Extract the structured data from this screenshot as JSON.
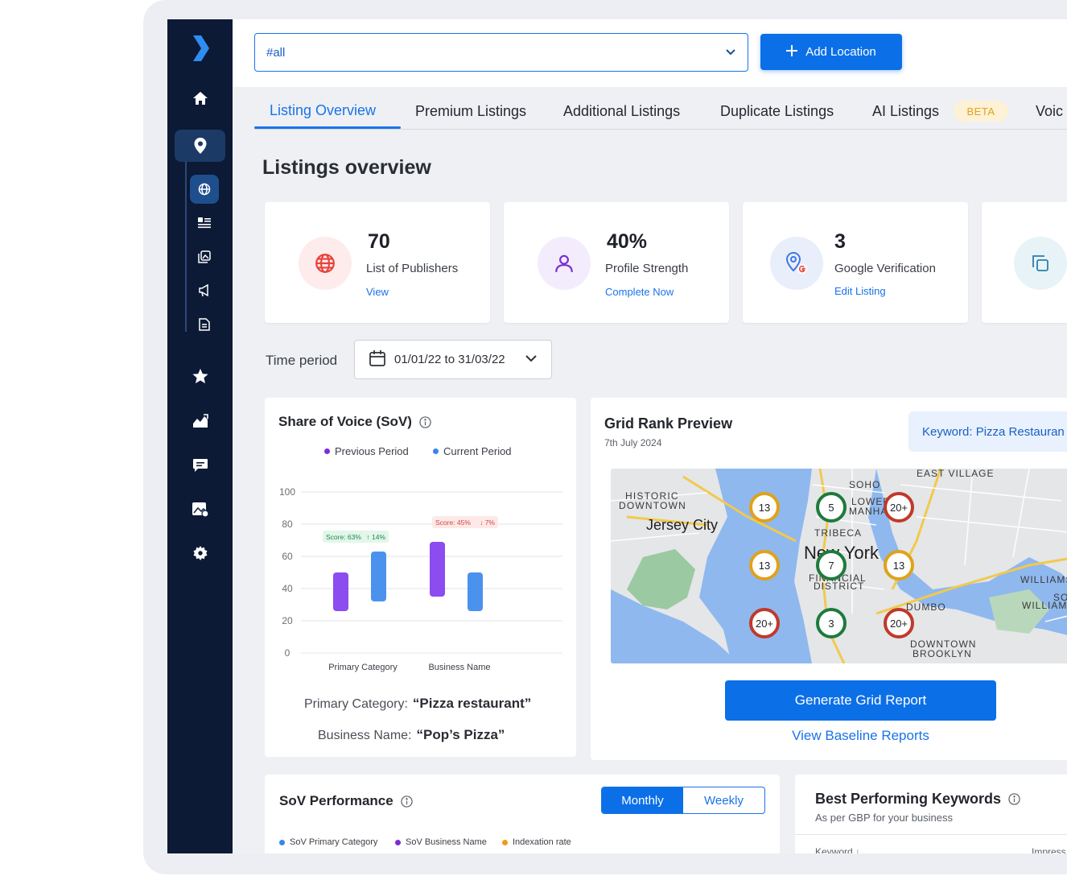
{
  "search": {
    "value": "#all"
  },
  "header": {
    "add_location_label": "Add Location"
  },
  "tabs": [
    {
      "label": "Listing Overview"
    },
    {
      "label": "Premium Listings"
    },
    {
      "label": "Additional Listings"
    },
    {
      "label": "Duplicate Listings"
    },
    {
      "label": "AI Listings"
    },
    {
      "label": "Voic"
    }
  ],
  "beta_label": "BETA",
  "page_title": "Listings overview",
  "stats": [
    {
      "value": "70",
      "label": "List of Publishers",
      "link": "View",
      "icon": "globe-icon",
      "color": "#e9423a"
    },
    {
      "value": "40%",
      "label": "Profile Strength",
      "link": "Complete Now",
      "icon": "user-icon",
      "color": "#7a2ed6"
    },
    {
      "value": "3",
      "label": "Google Verification",
      "link": "Edit Listing",
      "icon": "google-pin-icon",
      "color": "#3f76e8"
    }
  ],
  "time_period": {
    "label": "Time period",
    "value": "01/01/22 to 31/03/22"
  },
  "sov": {
    "title": "Share of Voice (SoV)",
    "primary_category_label": "Primary Category:",
    "primary_category_value": "“Pizza restaurant”",
    "business_name_label": "Business Name:",
    "business_name_value": "“Pop’s Pizza”"
  },
  "chart_data": {
    "type": "bar",
    "categories": [
      "Primary Category",
      "Business Name"
    ],
    "series": [
      {
        "name": "Previous Period",
        "color": "#8b4cf0",
        "ranges": [
          [
            26,
            50
          ],
          [
            35,
            69
          ]
        ]
      },
      {
        "name": "Current Period",
        "color": "#4a92ee",
        "ranges": [
          [
            32,
            63
          ],
          [
            26,
            50
          ]
        ]
      }
    ],
    "annotations": [
      {
        "category": "Primary Category",
        "score": "Score: 63%",
        "change": "↑ 14%",
        "trend": "up",
        "y": 71
      },
      {
        "category": "Business Name",
        "score": "Score: 45%",
        "change": "↓ 7%",
        "trend": "down",
        "y": 80
      }
    ],
    "yticks": [
      0,
      20,
      40,
      60,
      80,
      100
    ],
    "ylim": [
      0,
      100
    ]
  },
  "grid_rank": {
    "title": "Grid Rank Preview",
    "date": "7th July 2024",
    "keyword": "Keyword: Pizza Restauran",
    "generate_label": "Generate Grid Report",
    "baseline_label": "View Baseline Reports",
    "map_labels": [
      {
        "text": "HISTORIC"
      },
      {
        "text": "DOWNTOWN"
      },
      {
        "text": "Jersey City"
      },
      {
        "text": "SOHO"
      },
      {
        "text": "EAST VILLAGE"
      },
      {
        "text": "LOWER"
      },
      {
        "text": "MANHAT"
      },
      {
        "text": "TRIBECA"
      },
      {
        "text": "New York"
      },
      {
        "text": "FINANCIAL"
      },
      {
        "text": "DISTRICT"
      },
      {
        "text": "DUMBO"
      },
      {
        "text": "DOWNTOWN"
      },
      {
        "text": "BROOKLYN"
      },
      {
        "text": "WILLIAMS"
      },
      {
        "text": "SOUT"
      },
      {
        "text": "WILLIAM"
      }
    ],
    "pins": [
      {
        "label": "13",
        "color": "#e0a21a"
      },
      {
        "label": "5",
        "color": "#1e7a3c"
      },
      {
        "label": "20+",
        "color": "#c0392b"
      },
      {
        "label": "13",
        "color": "#e0a21a"
      },
      {
        "label": "7",
        "color": "#1e7a3c"
      },
      {
        "label": "13",
        "color": "#e0a21a"
      },
      {
        "label": "20+",
        "color": "#c0392b"
      },
      {
        "label": "3",
        "color": "#1e7a3c"
      },
      {
        "label": "20+",
        "color": "#c0392b"
      }
    ]
  },
  "sov_performance": {
    "title": "SoV Performance",
    "toggle": [
      "Monthly",
      "Weekly"
    ],
    "legend": [
      {
        "label": "SoV Primary Category",
        "color": "#3a86e8"
      },
      {
        "label": "SoV Business Name",
        "color": "#7a2ed6"
      },
      {
        "label": "Indexation rate",
        "color": "#f29a13"
      }
    ]
  },
  "keywords": {
    "title": "Best Performing Keywords",
    "subtitle": "As per GBP for your business",
    "columns": [
      "Keyword ↓",
      "Impress"
    ]
  }
}
